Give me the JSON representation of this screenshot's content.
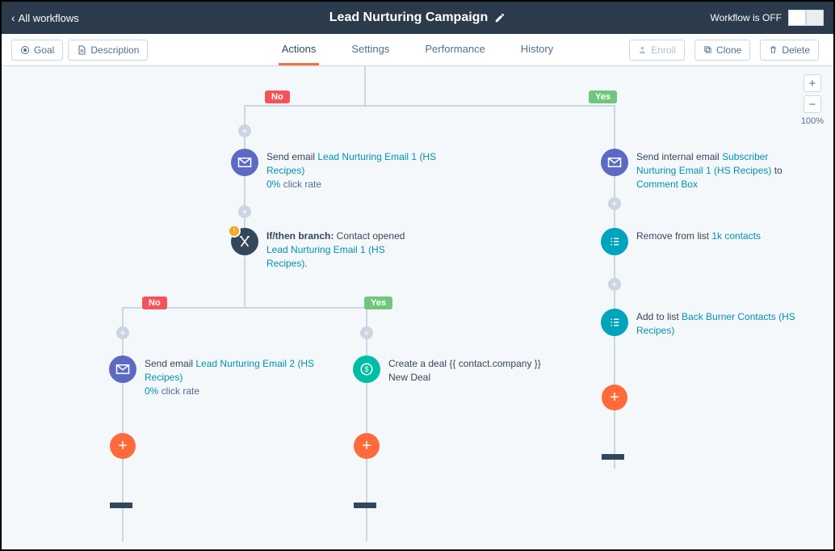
{
  "nav": {
    "back": "All workflows",
    "title": "Lead Nurturing Campaign",
    "status_label": "Workflow is OFF"
  },
  "subbar": {
    "goal": "Goal",
    "desc": "Description",
    "enroll": "Enroll",
    "clone": "Clone",
    "delete": "Delete"
  },
  "tabs": {
    "actions": "Actions",
    "settings": "Settings",
    "performance": "Performance",
    "history": "History"
  },
  "zoom": {
    "plus": "+",
    "minus": "−",
    "label": "100%"
  },
  "branches": {
    "no": "No",
    "yes": "Yes"
  },
  "nodes": {
    "left_email1": {
      "prefix": "Send email ",
      "link": "Lead Nurturing Email 1 (HS Recipes)",
      "rate_val": "0%",
      "rate_label": " click rate"
    },
    "branch1": {
      "prefix": "If/then branch:",
      "middle": " Contact opened ",
      "link": "Lead Nurturing Email 1 (HS Recipes)",
      "suffix": "."
    },
    "left2_email": {
      "prefix": "Send email ",
      "link": "Lead Nurturing Email 2 (HS Recipes)",
      "rate_val": "0%",
      "rate_label": " click rate"
    },
    "deal": {
      "text": "Create a deal {{ contact.company }} New Deal"
    },
    "right_email": {
      "prefix": "Send internal email ",
      "link1": "Subscriber Nurturing Email 1 (HS Recipes)",
      "to": " to ",
      "link2": "Comment Box"
    },
    "remove_list": {
      "prefix": "Remove from list ",
      "link": "1k contacts"
    },
    "add_list": {
      "prefix": "Add to list ",
      "link": "Back Burner Contacts (HS Recipes)"
    }
  }
}
